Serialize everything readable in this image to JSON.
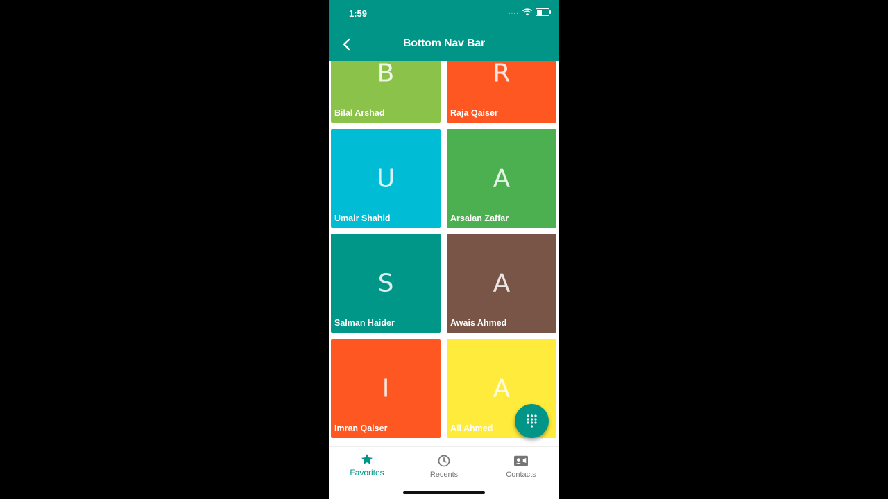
{
  "status_bar": {
    "time": "1:59",
    "dots": "...."
  },
  "app_bar": {
    "title": "Bottom Nav Bar"
  },
  "colors": {
    "primary": "#009587",
    "lime": "#8bc34a",
    "deep_orange": "#ff5722",
    "cyan": "#00bcd4",
    "green": "#4caf50",
    "teal": "#009688",
    "brown": "#795548",
    "yellow": "#ffeb3b"
  },
  "contacts": [
    {
      "letter": "B",
      "name": "Bilal Arshad",
      "color": "#8bc34a"
    },
    {
      "letter": "R",
      "name": "Raja Qaiser",
      "color": "#ff5722"
    },
    {
      "letter": "U",
      "name": "Umair Shahid",
      "color": "#00bcd4"
    },
    {
      "letter": "A",
      "name": "Arsalan Zaffar",
      "color": "#4caf50"
    },
    {
      "letter": "S",
      "name": "Salman Haider",
      "color": "#009688"
    },
    {
      "letter": "A",
      "name": "Awais Ahmed",
      "color": "#795548"
    },
    {
      "letter": "I",
      "name": "Imran Qaiser",
      "color": "#ff5722"
    },
    {
      "letter": "A",
      "name": "Ali Ahmed",
      "color": "#ffeb3b"
    }
  ],
  "fab": {
    "icon": "dialpad-icon"
  },
  "bottom_nav": [
    {
      "label": "Favorites",
      "icon": "star-icon",
      "active": true
    },
    {
      "label": "Recents",
      "icon": "clock-icon",
      "active": false
    },
    {
      "label": "Contacts",
      "icon": "contacts-icon",
      "active": false
    }
  ]
}
